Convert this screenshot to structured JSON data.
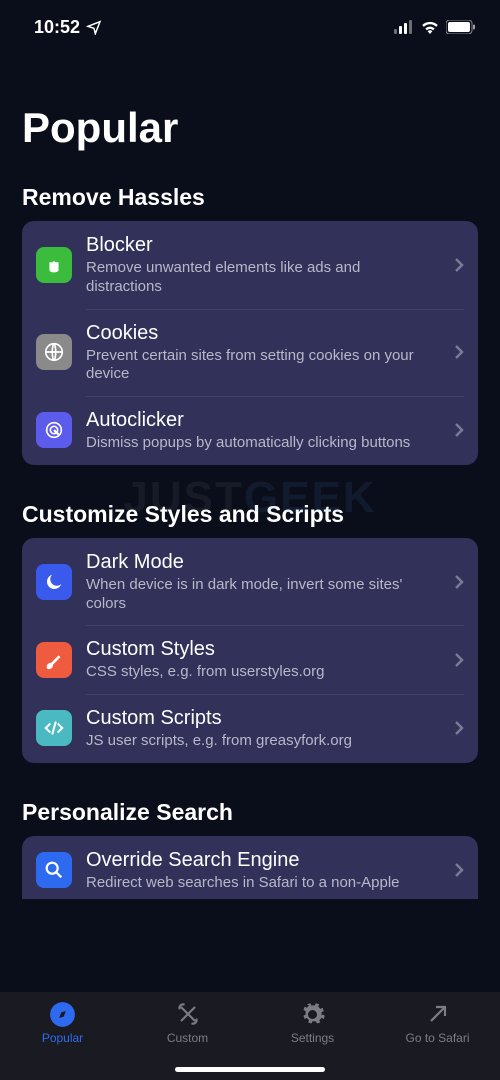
{
  "status": {
    "time": "10:52"
  },
  "page": {
    "title": "Popular"
  },
  "sections": [
    {
      "title": "Remove Hassles",
      "items": [
        {
          "title": "Blocker",
          "subtitle": "Remove unwanted elements like ads and distractions"
        },
        {
          "title": "Cookies",
          "subtitle": "Prevent certain sites from setting cookies on your device"
        },
        {
          "title": "Autoclicker",
          "subtitle": "Dismiss popups by automatically clicking buttons"
        }
      ]
    },
    {
      "title": "Customize Styles and Scripts",
      "items": [
        {
          "title": "Dark Mode",
          "subtitle": "When device is in dark mode, invert some sites' colors"
        },
        {
          "title": "Custom Styles",
          "subtitle": "CSS styles, e.g. from userstyles.org"
        },
        {
          "title": "Custom Scripts",
          "subtitle": "JS user scripts, e.g. from greasyfork.org"
        }
      ]
    },
    {
      "title": "Personalize Search",
      "items": [
        {
          "title": "Override Search Engine",
          "subtitle": "Redirect web searches in Safari to a non-Apple"
        }
      ]
    }
  ],
  "tabs": {
    "popular": "Popular",
    "custom": "Custom",
    "settings": "Settings",
    "safari": "Go to Safari"
  }
}
